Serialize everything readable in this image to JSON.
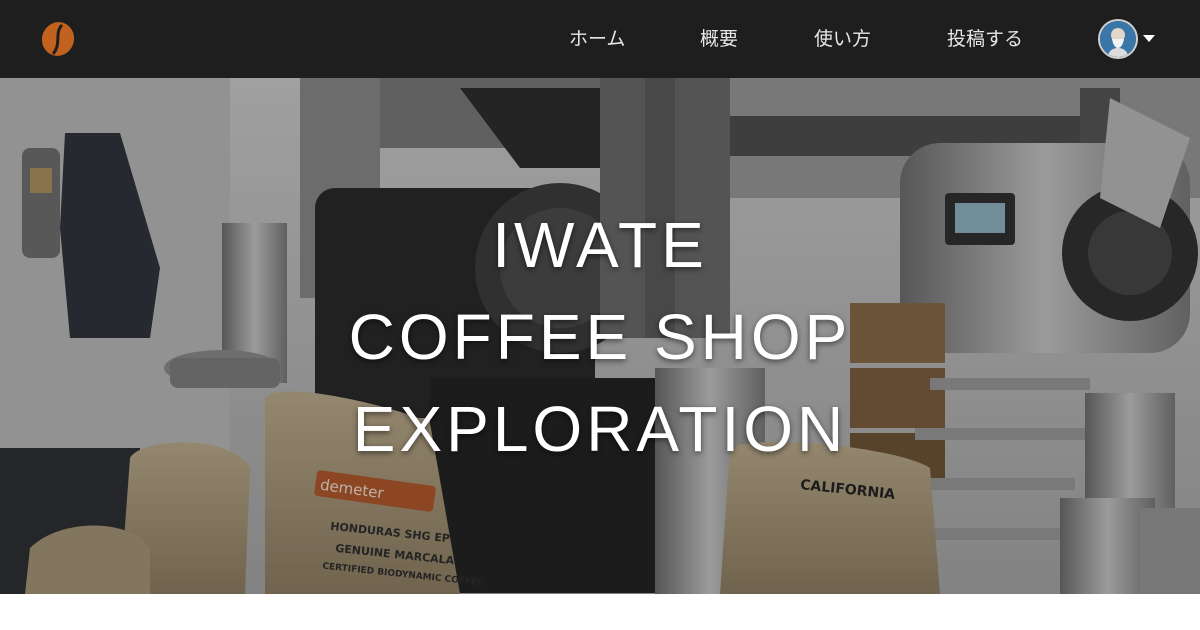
{
  "nav": {
    "items": [
      {
        "label": "ホーム"
      },
      {
        "label": "概要"
      },
      {
        "label": "使い方"
      },
      {
        "label": "投稿する"
      }
    ]
  },
  "hero": {
    "line1": "IWATE",
    "line2": "COFFEE SHOP",
    "line3": "EXPLORATION"
  },
  "bag_labels": {
    "demeter": "demeter",
    "honduras_1": "HONDURAS SHG EP",
    "honduras_2": "GENUINE MARCALA",
    "honduras_3": "CERTIFIED BIODYNAMIC COFFEE",
    "california": "CALIFORNIA"
  },
  "colors": {
    "navbar": "#1e1e1e",
    "logo": "#c2621f",
    "hero_text": "#ffffff"
  },
  "icons": {
    "logo": "coffee-bean-icon",
    "avatar": "user-avatar",
    "caret": "caret-down-icon"
  }
}
